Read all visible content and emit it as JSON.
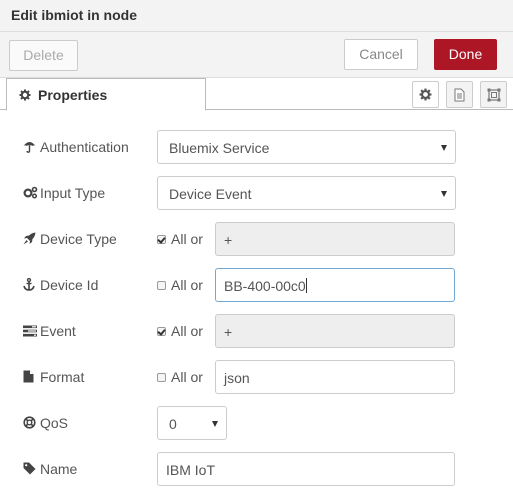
{
  "header": {
    "title": "Edit ibmiot in node"
  },
  "toolbar": {
    "delete_label": "Delete",
    "cancel_label": "Cancel",
    "done_label": "Done",
    "done_color": "#ad1625"
  },
  "tabs": {
    "properties_label": "Properties"
  },
  "form": {
    "authentication": {
      "label": "Authentication",
      "value": "Bluemix Service",
      "icon": "umbrella-icon"
    },
    "input_type": {
      "label": "Input Type",
      "value": "Device Event",
      "icon": "cogs-icon"
    },
    "device_type": {
      "label": "Device Type",
      "all_checked": true,
      "all_label": "All or",
      "value": "+",
      "icon": "rocket-icon"
    },
    "device_id": {
      "label": "Device Id",
      "all_checked": false,
      "all_label": "All or",
      "value": "BB-400-00c0",
      "icon": "anchor-icon"
    },
    "event": {
      "label": "Event",
      "all_checked": true,
      "all_label": "All or",
      "value": "+",
      "icon": "tasks-icon"
    },
    "format": {
      "label": "Format",
      "all_checked": false,
      "all_label": "All or",
      "value": "json",
      "icon": "file-icon"
    },
    "qos": {
      "label": "QoS",
      "value": "0",
      "icon": "life-ring-icon"
    },
    "name": {
      "label": "Name",
      "value": "IBM IoT",
      "icon": "tag-icon"
    }
  }
}
